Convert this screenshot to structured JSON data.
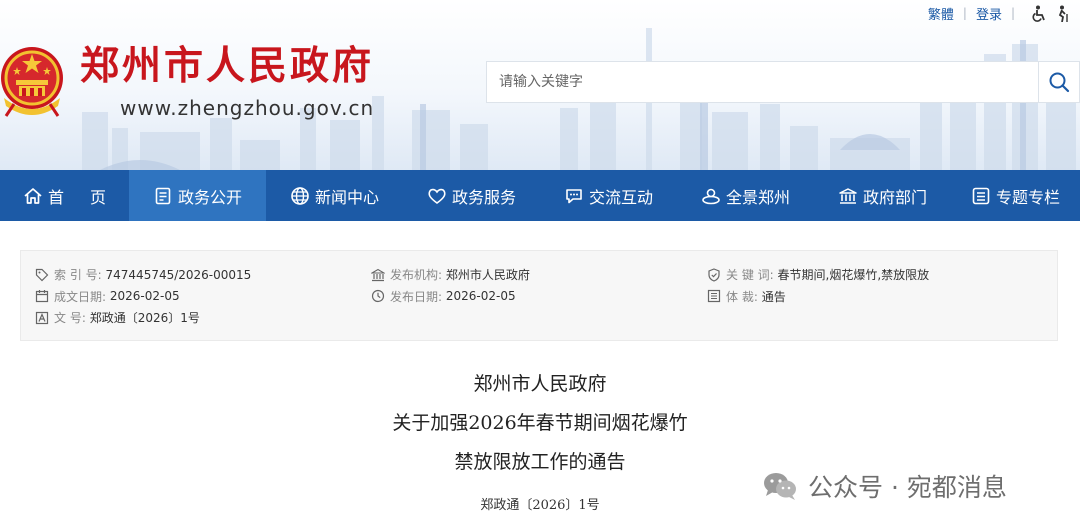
{
  "toplinks": {
    "traditional": "繁體",
    "login": "登录"
  },
  "header": {
    "title": "郑州市人民政府",
    "url": "www.zhengzhou.gov.cn"
  },
  "search": {
    "placeholder": "请输入关键字"
  },
  "nav": {
    "items": [
      {
        "label": "首页",
        "icon": "home-icon"
      },
      {
        "label": "政务公开",
        "icon": "document-icon",
        "active": true
      },
      {
        "label": "新闻中心",
        "icon": "globe-icon"
      },
      {
        "label": "政务服务",
        "icon": "heart-icon"
      },
      {
        "label": "交流互动",
        "icon": "chat-icon"
      },
      {
        "label": "全景郑州",
        "icon": "panorama-icon"
      },
      {
        "label": "政府部门",
        "icon": "building-icon"
      },
      {
        "label": "专题专栏",
        "icon": "list-icon"
      }
    ]
  },
  "meta": {
    "index_key": "索 引 号:",
    "index_val": "747445745/2026-00015",
    "date_key": "成文日期:",
    "date_val": "2026-02-05",
    "doc_key": "文 号:",
    "doc_val": "郑政通〔2026〕1号",
    "org_key": "发布机构:",
    "org_val": "郑州市人民政府",
    "pub_key": "发布日期:",
    "pub_val": "2026-02-05",
    "kw_key": "关 键 词:",
    "kw_val": "春节期间,烟花爆竹,禁放限放",
    "type_key": "体 裁:",
    "type_val": "通告"
  },
  "article": {
    "title_line1": "郑州市人民政府",
    "title_line2": "关于加强2026年春节期间烟花爆竹",
    "title_line3": "禁放限放工作的通告",
    "doc_number": "郑政通〔2026〕1号"
  },
  "watermark": {
    "text": "公众号 · 宛都消息"
  },
  "colors": {
    "brand_red": "#c8161d",
    "nav_blue": "#1c5aa6",
    "nav_active": "#2f74c0"
  }
}
